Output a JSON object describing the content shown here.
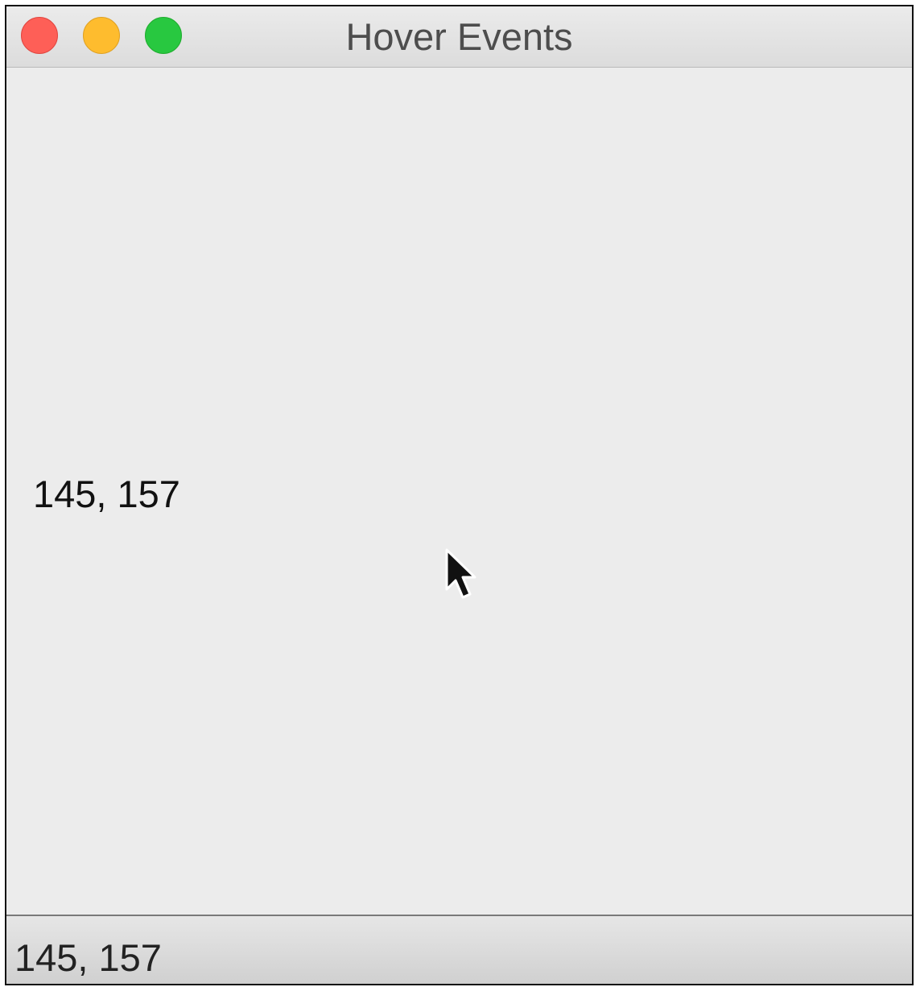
{
  "window": {
    "title": "Hover Events",
    "controls": {
      "close_color": "#fe5f57",
      "minimize_color": "#febc2e",
      "zoom_color": "#28c840"
    }
  },
  "content": {
    "coordinates_label": "145, 157",
    "cursor_icon": "arrow-pointer-icon"
  },
  "statusbar": {
    "text": "145, 157"
  }
}
